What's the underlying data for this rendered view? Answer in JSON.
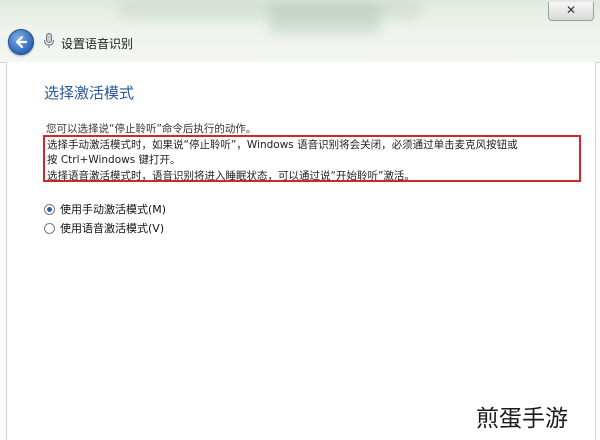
{
  "window": {
    "close_label": "✕",
    "title": "设置语音识别"
  },
  "main": {
    "heading": "选择激活模式",
    "intro": "您可以选择说“停止聆听”命令后执行的动作。",
    "descriptions": [
      "选择手动激活模式时，如果说“停止聆听”，Windows 语音识别将会关闭，必须通过单击麦克风按钮或",
      "按 Ctrl+Windows 键打开。",
      "选择语音激活模式时，语音识别将进入睡眠状态，可以通过说“开始聆听”激活。"
    ],
    "options": [
      {
        "label": "使用手动激活模式(M)",
        "selected": true
      },
      {
        "label": "使用语音激活模式(V)",
        "selected": false
      }
    ]
  },
  "watermark": "煎蛋手游",
  "colors": {
    "heading": "#2b579a",
    "highlight_border": "#d0282a",
    "back_button": "#2d66b5"
  },
  "icons": {
    "back": "back-arrow-icon",
    "microphone": "microphone-icon",
    "close": "close-icon"
  }
}
